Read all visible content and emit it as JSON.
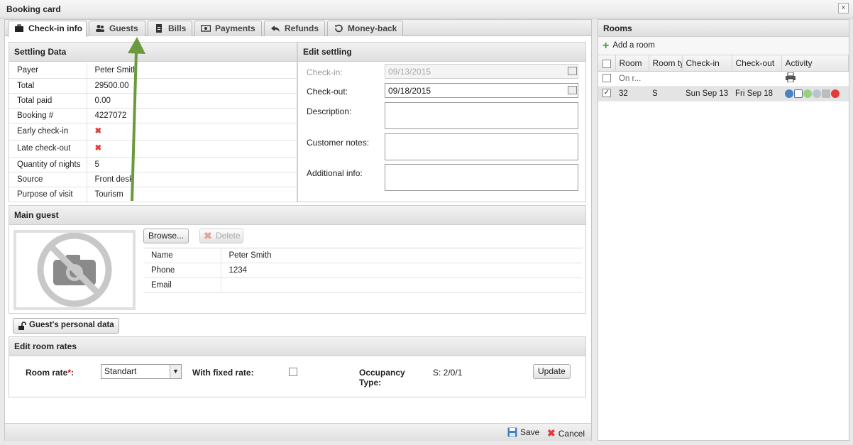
{
  "window": {
    "title": "Booking card",
    "close": "×"
  },
  "tabs": [
    {
      "label": "Check-in info",
      "icon": "briefcase-icon"
    },
    {
      "label": "Guests",
      "icon": "users-icon"
    },
    {
      "label": "Bills",
      "icon": "document-icon"
    },
    {
      "label": "Payments",
      "icon": "money-icon"
    },
    {
      "label": "Refunds",
      "icon": "reply-icon"
    },
    {
      "label": "Money-back",
      "icon": "undo-icon"
    }
  ],
  "settling": {
    "title": "Settling Data",
    "rows": [
      {
        "label": "Payer",
        "value": "Peter Smith"
      },
      {
        "label": "Total",
        "value": "29500.00"
      },
      {
        "label": "Total paid",
        "value": "0.00"
      },
      {
        "label": "Booking #",
        "value": "4227072"
      },
      {
        "label": "Early check-in",
        "value": "✖"
      },
      {
        "label": "Late check-out",
        "value": "✖"
      },
      {
        "label": "Quantity of nights",
        "value": "5"
      },
      {
        "label": "Source",
        "value": "Front desk"
      },
      {
        "label": "Purpose of visit",
        "value": "Tourism"
      }
    ]
  },
  "edit_settling": {
    "title": "Edit settling",
    "checkin_label": "Check-in:",
    "checkin_value": "09/13/2015",
    "checkout_label": "Check-out:",
    "checkout_value": "09/18/2015",
    "description_label": "Description:",
    "customer_notes_label": "Customer notes:",
    "additional_info_label": "Additional info:"
  },
  "main_guest": {
    "title": "Main guest",
    "browse_label": "Browse...",
    "delete_label": "Delete",
    "rows": [
      {
        "label": "Name",
        "value": "Peter Smith"
      },
      {
        "label": "Phone",
        "value": "1234"
      },
      {
        "label": "Email",
        "value": ""
      }
    ],
    "personal_data_label": "Guest's personal data"
  },
  "room_rates": {
    "title": "Edit room rates",
    "room_rate_label": "Room rate",
    "required_mark": "*",
    "colon": ":",
    "room_rate_value": "Standart",
    "fixed_rate_label": "With fixed rate:",
    "occupancy_label_1": "Occupancy",
    "occupancy_label_2": "Type:",
    "occupancy_value": "S: 2/0/1",
    "update_label": "Update"
  },
  "footer": {
    "save_label": "Save",
    "cancel_label": "Cancel"
  },
  "rooms": {
    "title": "Rooms",
    "add_label": "Add a room",
    "columns": [
      "Room",
      "Room ty",
      "Check-in",
      "Check-out",
      "Activity"
    ],
    "rows": [
      {
        "room": "On r...",
        "type": "",
        "checkin": "",
        "checkout": "",
        "checked": false
      },
      {
        "room": "32",
        "type": "S",
        "checkin": "Sun Sep 13",
        "checkout": "Fri Sep 18",
        "checked": true
      }
    ]
  },
  "colors": {
    "accent_green": "#6a9a3a",
    "red": "#e23b3b"
  }
}
